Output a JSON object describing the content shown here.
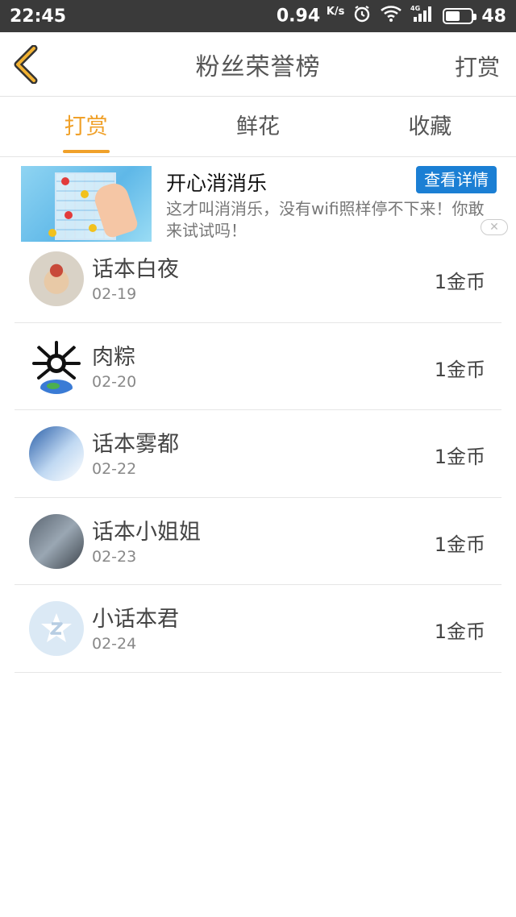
{
  "status_bar": {
    "time": "22:45",
    "speed": "0.94",
    "speed_unit": "K/s",
    "battery": "48",
    "battery_level_pct": 48,
    "icons": [
      "alarm-icon",
      "wifi-icon",
      "signal-4g-icon",
      "battery-icon"
    ]
  },
  "header": {
    "title": "粉丝荣誉榜",
    "action_label": "打赏",
    "back_icon": "chevron-left-icon",
    "accent_color": "#f0a12a"
  },
  "tabs": [
    {
      "label": "打赏",
      "active": true
    },
    {
      "label": "鲜花",
      "active": false
    },
    {
      "label": "收藏",
      "active": false
    }
  ],
  "ad": {
    "title": "开心消消乐",
    "button_label": "查看详情",
    "description": "这才叫消消乐，没有wifi照样停不下来！你敢来试试吗！",
    "close_icon": "close-icon",
    "button_color": "#1b7fd4"
  },
  "list": [
    {
      "name": "话本白夜",
      "date": "02-19",
      "amount": "1金币"
    },
    {
      "name": "肉粽",
      "date": "02-20",
      "amount": "1金币"
    },
    {
      "name": "话本雾都",
      "date": "02-22",
      "amount": "1金币"
    },
    {
      "name": "话本小姐姐",
      "date": "02-23",
      "amount": "1金币"
    },
    {
      "name": "小话本君",
      "date": "02-24",
      "amount": "1金币"
    }
  ]
}
